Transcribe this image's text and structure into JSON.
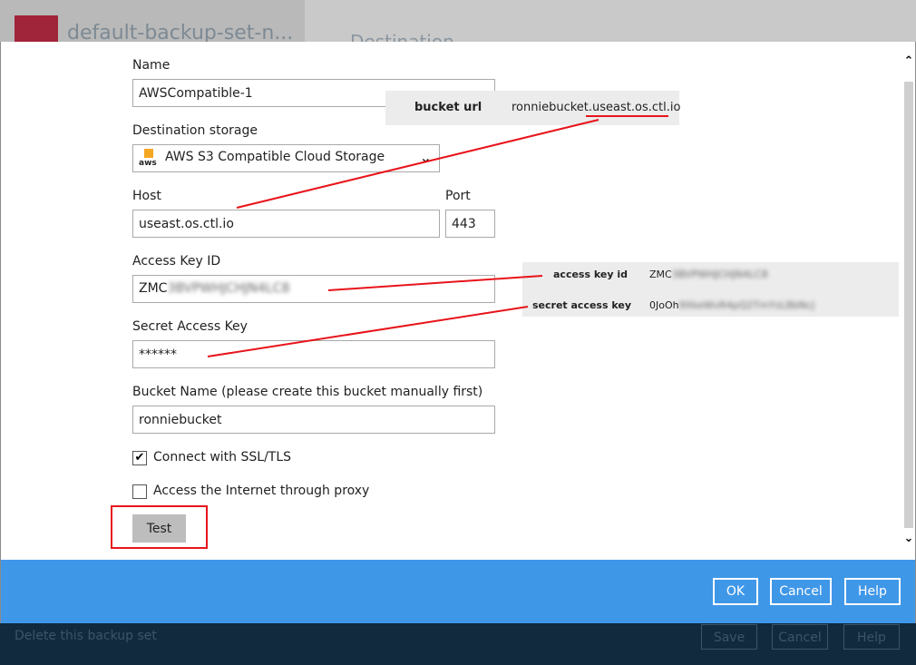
{
  "background": {
    "title": "default-backup-set-n...",
    "section": "Destination",
    "delete_label": "Delete this backup set",
    "buttons": {
      "save": "Save",
      "cancel": "Cancel",
      "help": "Help"
    }
  },
  "form": {
    "name_label": "Name",
    "name_value": "AWSCompatible-1",
    "storage_label": "Destination storage",
    "storage_value": "AWS S3 Compatible Cloud Storage",
    "storage_icon_text": "aws",
    "host_label": "Host",
    "host_value": "useast.os.ctl.io",
    "port_label": "Port",
    "port_value": "443",
    "access_key_label": "Access Key ID",
    "access_key_value": "ZMC",
    "access_key_hidden": "3BVPWHJCHJN4LC8",
    "secret_key_label": "Secret Access Key",
    "secret_key_value": "******",
    "bucket_label": "Bucket Name (please create this bucket manually first)",
    "bucket_value": "ronniebucket",
    "ssl_label": "Connect with SSL/TLS",
    "ssl_checked": true,
    "proxy_label": "Access the Internet through proxy",
    "proxy_checked": false,
    "test_button": "Test"
  },
  "callouts": {
    "bucket_url_key": "bucket url",
    "bucket_url_prefix": "ronniebucket.",
    "bucket_url_host": "useast.os.ctl.io",
    "access_key_id_key": "access key id",
    "access_key_id_value": "ZMC",
    "access_key_id_hidden": "3BVPWHJCHJN4LC8",
    "secret_access_key_key": "secret access key",
    "secret_access_key_value": "0JoOh",
    "secret_access_key_hidden": "9XkeWvR4pQ2TmYsL8bNcJ"
  },
  "footer": {
    "ok": "OK",
    "cancel": "Cancel",
    "help": "Help"
  },
  "colors": {
    "footer_blue": "#3f97e8",
    "annotation_red": "#e8141b",
    "dark_bar": "#112a3e"
  }
}
